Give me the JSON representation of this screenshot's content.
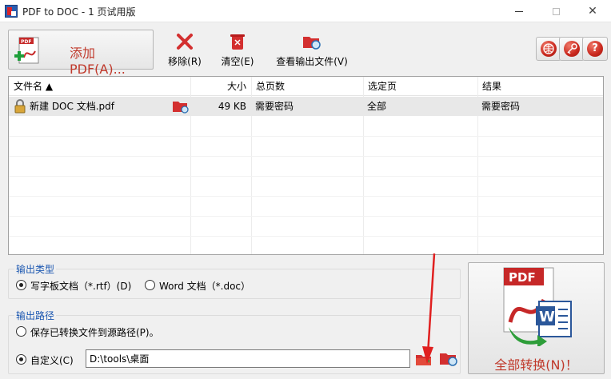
{
  "window": {
    "title": "PDF to DOC - 1 页试用版",
    "minimize_icon": "minimize-icon",
    "maximize_icon": "maximize-icon",
    "close_glyph": "✕"
  },
  "toolbar": {
    "add_pdf_label": "添加 PDF(A)...",
    "remove_label": "移除(R)",
    "clear_label": "清空(E)",
    "view_output_label": "查看输出文件(V)",
    "help_glyph": "?",
    "accent_color": "#c0392b"
  },
  "table": {
    "columns": [
      "文件名 ▲",
      "大小",
      "总页数",
      "选定页",
      "结果"
    ],
    "rows": [
      {
        "name": "新建 DOC 文档.pdf",
        "size": "49 KB",
        "total_pages": "需要密码",
        "selected_pages": "全部",
        "result": "需要密码",
        "icon": "lock-icon"
      }
    ]
  },
  "output_type": {
    "group_label": "输出类型",
    "options": [
      {
        "label": "写字板文档（*.rtf）(D)",
        "checked": true
      },
      {
        "label": "Word 文档（*.doc）",
        "checked": false
      }
    ]
  },
  "output_path": {
    "group_label": "输出路径",
    "options": [
      {
        "label": "保存已转换文件到源路径(P)。",
        "checked": false
      },
      {
        "label": "自定义(C)",
        "checked": true
      }
    ],
    "path_value": "D:\\tools\\桌面"
  },
  "convert": {
    "label": "全部转换(N)！"
  }
}
